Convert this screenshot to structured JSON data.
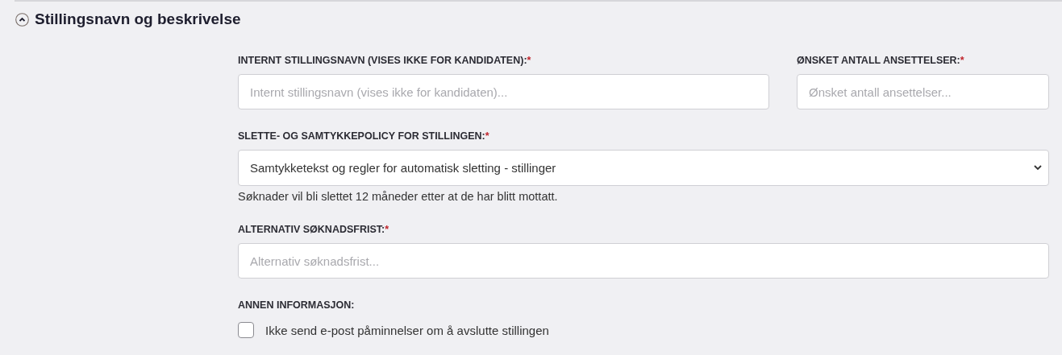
{
  "section": {
    "title": "Stillingsnavn og beskrivelse",
    "expanded": true
  },
  "rows": [
    [
      {
        "kind": "text",
        "label": "INTERNT STILLINGSNAVN (VISES IKKE FOR KANDIDATEN):",
        "required_mark": "*",
        "placeholder": "Internt stillingsnavn (vises ikke for kandidaten)..."
      },
      {
        "kind": "text",
        "label": "ØNSKET ANTALL ANSETTELSER:",
        "required_mark": "*",
        "placeholder": "Ønsket antall ansettelser..."
      }
    ],
    [
      {
        "kind": "select",
        "label": "SLETTE- OG SAMTYKKEPOLICY FOR STILLINGEN:",
        "required_mark": "*",
        "value": "Samtykketekst og regler for automatisk sletting - stillinger",
        "help": "Søknader vil bli slettet 12 måneder etter at de har blitt mottatt."
      }
    ],
    [
      {
        "kind": "text",
        "label": "ALTERNATIV SØKNADSFRIST:",
        "required_mark": "*",
        "placeholder": "Alternativ søknadsfrist..."
      }
    ],
    [
      {
        "kind": "checkboxes",
        "label": "ANNEN INFORMASJON:",
        "options": [
          {
            "label": "Ikke send e-post påminnelser om å avslutte stillingen",
            "checked": false
          }
        ]
      }
    ]
  ]
}
